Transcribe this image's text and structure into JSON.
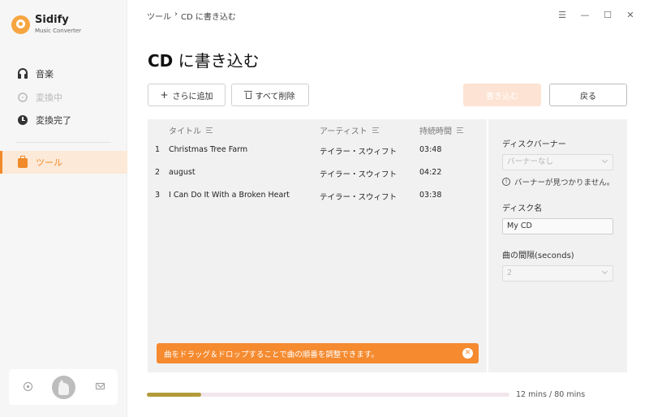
{
  "app": {
    "name": "Sidify",
    "subtitle": "Music Converter"
  },
  "sidebar": {
    "items": [
      {
        "label": "音楽",
        "icon": "headphones-icon",
        "state": "normal"
      },
      {
        "label": "変換中",
        "icon": "converting-icon",
        "state": "disabled"
      },
      {
        "label": "変換完了",
        "icon": "clock-icon",
        "state": "normal"
      },
      {
        "label": "ツール",
        "icon": "toolbox-icon",
        "state": "active"
      }
    ]
  },
  "header": {
    "breadcrumb": {
      "parent": "ツール",
      "separator": "›",
      "current": "CD に書き込む"
    },
    "window_controls": [
      "☰",
      "—",
      "☐",
      "✕"
    ]
  },
  "page": {
    "title_bold": "CD",
    "title_rest": " に書き込む"
  },
  "toolbar": {
    "add_label": "さらに追加",
    "add_icon": "+",
    "delete_all_label": "すべて削除",
    "burn_label": "書き込む",
    "back_label": "戻る"
  },
  "table": {
    "headers": {
      "title": "タイトル",
      "artist": "アーティスト",
      "duration": "持続時間"
    },
    "rows": [
      {
        "num": "1",
        "title": "Christmas Tree Farm",
        "artist": "テイラー・スウィフト",
        "duration": "03:48"
      },
      {
        "num": "2",
        "title": "august",
        "artist": "テイラー・スウィフト",
        "duration": "04:22"
      },
      {
        "num": "3",
        "title": "I Can Do It With a Broken Heart",
        "artist": "テイラー・スウィフト",
        "duration": "03:38"
      }
    ]
  },
  "hint": {
    "text": "曲をドラッグ＆ドロップすることで曲の順番を調整できます。",
    "close_icon": "✕"
  },
  "disc_panel": {
    "banner_label": "ディスクバーナー",
    "banner_value": "バーナーなし",
    "banner_warning": "バーナーが見つかりません。",
    "warning_icon": "!",
    "name_label": "ディスク名",
    "name_value": "My CD",
    "interval_label": "曲の間隔(seconds)",
    "interval_value": "2"
  },
  "capacity": {
    "used_fraction": 0.15,
    "label": "12 mins / 80 mins"
  },
  "colors": {
    "accent": "#f58a2f",
    "active_bg": "#fde9d7",
    "progress_fill": "#b39b3b"
  }
}
